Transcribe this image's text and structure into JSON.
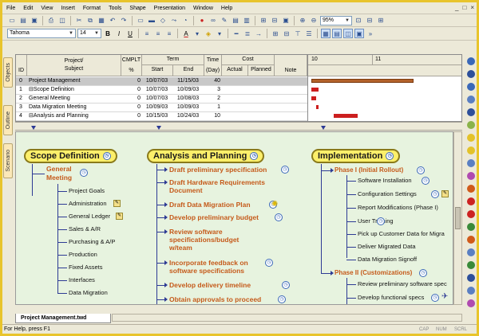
{
  "menu": [
    "File",
    "Edit",
    "View",
    "Insert",
    "Format",
    "Tools",
    "Shape",
    "Presentation",
    "Window",
    "Help"
  ],
  "window_controls": [
    "_",
    "□",
    "×"
  ],
  "toolbar": {
    "zoom": "95%",
    "font_name": "Tahoma",
    "font_size": "14"
  },
  "left_tabs": [
    "Objects",
    "Outline",
    "Scenario"
  ],
  "gantt": {
    "headers": {
      "id": "ID",
      "subject": "Project/\nSubject",
      "cmplt": "CMPLT",
      "pct": "%",
      "term": "Term",
      "start": "Start",
      "end": "End",
      "time": "Time",
      "day": "(Day)",
      "cost": "Cost",
      "actual": "Actual",
      "planned": "Planned",
      "note": "Note"
    },
    "chart_ticks": [
      "10",
      "11"
    ],
    "rows": [
      {
        "id": "0",
        "subject": "Project Management",
        "pct": "0",
        "start": "10/07/03",
        "end": "11/15/03",
        "days": "40"
      },
      {
        "id": "1",
        "subject": "⊟Scope Definition",
        "pct": "0",
        "start": "10/07/03",
        "end": "10/09/03",
        "days": "3"
      },
      {
        "id": "2",
        "subject": "General  Meeting",
        "pct": "0",
        "start": "10/07/03",
        "end": "10/08/03",
        "days": "2"
      },
      {
        "id": "3",
        "subject": "Data Migration  Meeting",
        "pct": "0",
        "start": "10/09/03",
        "end": "10/09/03",
        "days": "1"
      },
      {
        "id": "4",
        "subject": "⊟Analysis and Planning",
        "pct": "0",
        "start": "10/15/03",
        "end": "10/24/03",
        "days": "10"
      }
    ]
  },
  "map": {
    "scope": {
      "title": "Scope Definition",
      "sub": "General\nMeeting",
      "leaves": [
        "Project Goals",
        "Administration",
        "General Ledger",
        "Sales & A/R",
        "Purchasing & A/P",
        "Production",
        "Fixed Assets",
        "Interfaces",
        "Data Migration"
      ]
    },
    "analysis": {
      "title": "Analysis and Planning",
      "items": [
        "Draft preliminary specification",
        "Draft Hardware Requirements\nDocument",
        "Draft Data Migration Plan",
        "Develop preliminary budget",
        "Review software\nspecifications/budget\nw/team",
        "Incorporate feedback on\nsoftware specifications",
        "Develop delivery timeline",
        "Obtain approvals to proceed"
      ]
    },
    "implementation": {
      "title": "Implementation",
      "phase1": "Phase I (Initial Rollout)",
      "phase1_items": [
        "Software Installation",
        "Configuration Settings",
        "Report Modifications (Phase I)",
        "User Training",
        "Pick up Customer Data for Migra",
        "Deliver Migrated Data",
        "Data Migration Signoff"
      ],
      "phase2": "Phase II (Customizations)",
      "phase2_items": [
        "Review preliminary software spec",
        "Develop functional specs"
      ]
    }
  },
  "doc_tab": "Project Management.twd",
  "status": {
    "text": "For Help, press F1",
    "indicators": [
      "CAP",
      "NUM",
      "SCRL"
    ]
  },
  "colors": {
    "topic_fill": "#fcef6a",
    "subtopic_text": "#c55a1a",
    "connector": "#2d3a94",
    "canvas": "#e7f3df",
    "frame": "#e8c42c",
    "bar_red": "#cc1f1f",
    "bar_summary": "#b3622a"
  }
}
